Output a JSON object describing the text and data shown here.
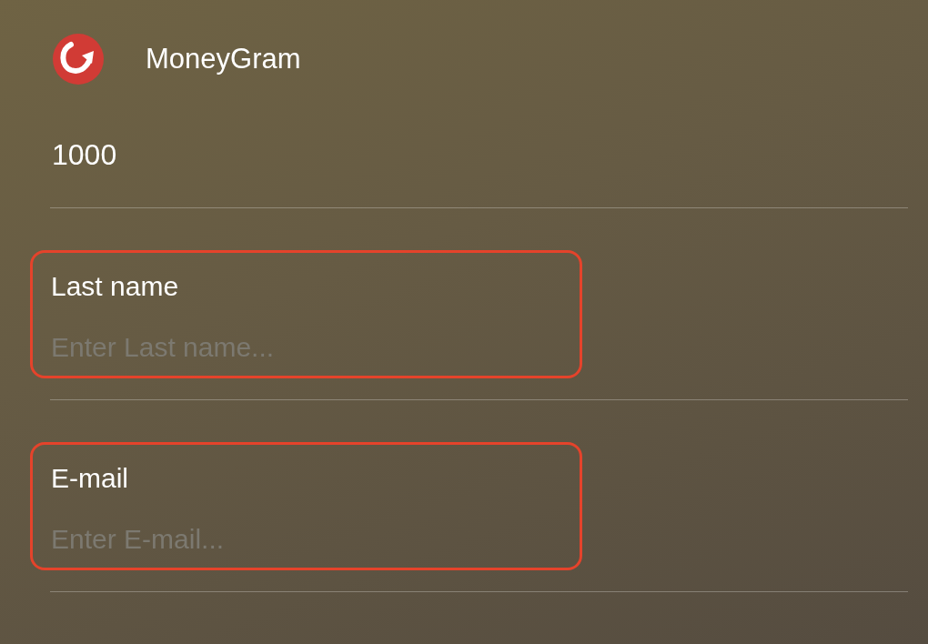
{
  "app": {
    "name": "MoneyGram"
  },
  "fields": [
    {
      "kind": "value",
      "value": "1000"
    },
    {
      "kind": "labeled",
      "label": "Last name",
      "placeholder": "Enter Last name...",
      "highlighted": true
    },
    {
      "kind": "labeled",
      "label": "E-mail",
      "placeholder": "Enter E-mail...",
      "highlighted": true
    }
  ]
}
